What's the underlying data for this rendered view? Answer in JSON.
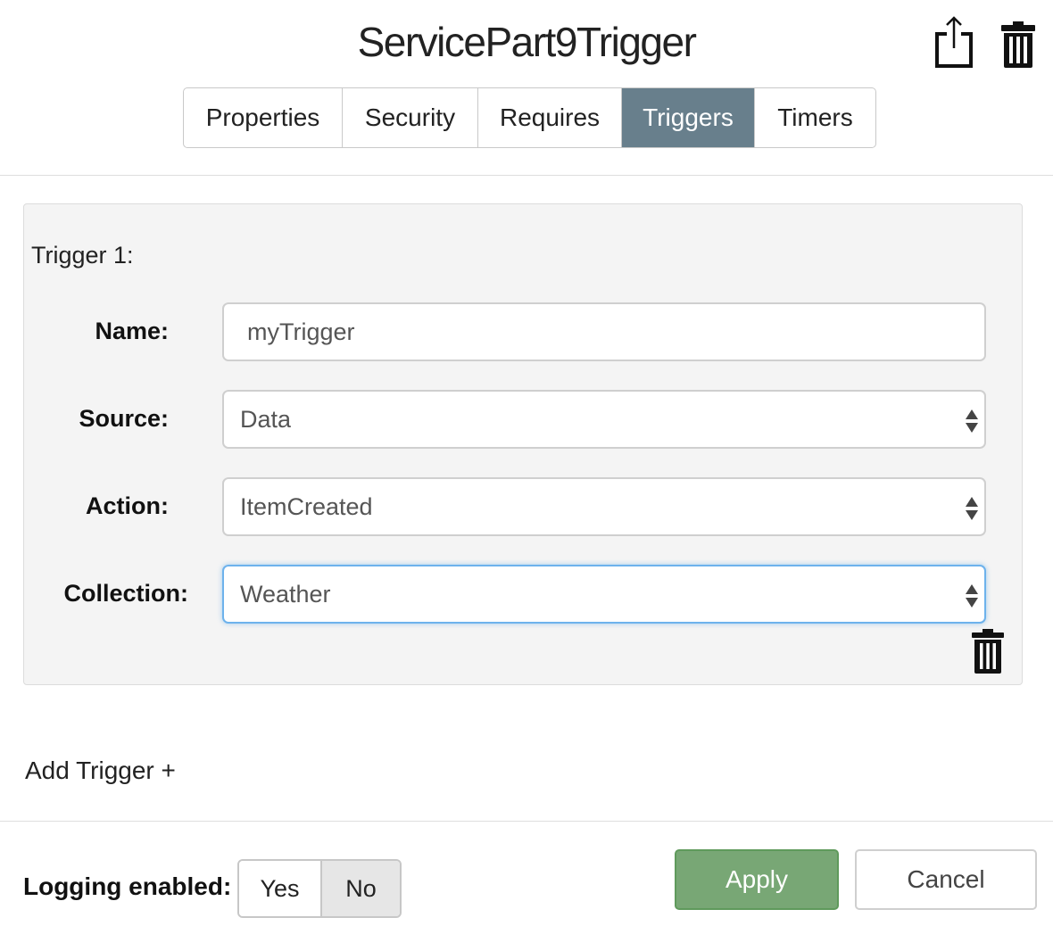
{
  "header": {
    "title": "ServicePart9Trigger",
    "export_icon": "export-share-icon",
    "delete_icon": "trash-icon"
  },
  "tabs": [
    {
      "label": "Properties",
      "active": false
    },
    {
      "label": "Security",
      "active": false
    },
    {
      "label": "Requires",
      "active": false
    },
    {
      "label": "Triggers",
      "active": true
    },
    {
      "label": "Timers",
      "active": false
    }
  ],
  "trigger": {
    "heading": "Trigger 1:",
    "name_label": "Name:",
    "name_value": "myTrigger",
    "source_label": "Source:",
    "source_value": "Data",
    "action_label": "Action:",
    "action_value": "ItemCreated",
    "collection_label": "Collection:",
    "collection_value": "Weather",
    "delete_icon": "trash-icon"
  },
  "add_trigger_label": "Add Trigger +",
  "footer": {
    "logging_label": "Logging enabled:",
    "yes_label": "Yes",
    "no_label": "No",
    "logging_selected": "No",
    "apply_label": "Apply",
    "cancel_label": "Cancel"
  },
  "colors": {
    "active_tab": "#687f8c",
    "apply_button": "#78a775",
    "focus_border": "#6db2ec",
    "panel_bg": "#f4f4f4"
  }
}
